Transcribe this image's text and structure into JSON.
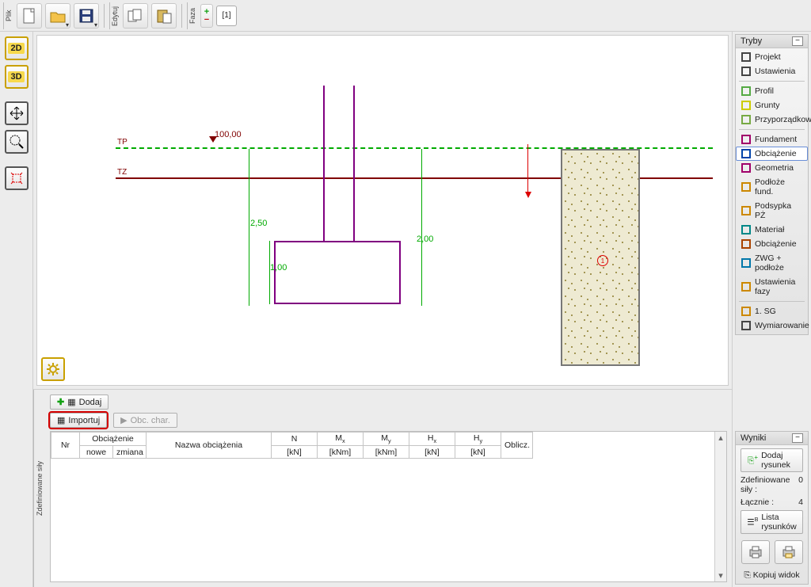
{
  "top": {
    "vert_labels": {
      "plik": "Plik",
      "edytuj": "Edytuj",
      "faza": "Faza"
    },
    "tab_label": "[1]"
  },
  "left": {
    "labels": {
      "btn2d": "2D",
      "btn3d": "3D"
    }
  },
  "canvas": {
    "tp": "TP",
    "tz": "TZ",
    "dim_100": "100,00",
    "dim_250": "2,50",
    "dim_100b": "1,00",
    "dim_200": "2,00",
    "soil_ring": "1"
  },
  "bottom": {
    "vert_label": "Zdefiniowane siły",
    "btn_dodaj": "Dodaj",
    "btn_importuj": "Importuj",
    "btn_obc_char": "Obc. char.",
    "headers": {
      "nr": "Nr",
      "obc": "Obciążenie",
      "obc_sub1": "nowe",
      "obc_sub2": "zmiana",
      "nazwa": "Nazwa obciążenia",
      "n": "N",
      "n_u": "[kN]",
      "mx": "M",
      "mx_u": "[kNm]",
      "my": "M",
      "my_u": "[kNm]",
      "hx": "H",
      "hx_u": "[kN]",
      "hy": "H",
      "hy_u": "[kN]",
      "oblicz": "Oblicz."
    }
  },
  "right": {
    "tryby_title": "Tryby",
    "items": [
      {
        "label": "Projekt",
        "icon": "list"
      },
      {
        "label": "Ustawienia",
        "icon": "gear"
      },
      {
        "label": "Profil",
        "icon": "profile"
      },
      {
        "label": "Grunty",
        "icon": "soil"
      },
      {
        "label": "Przyporządkow.",
        "icon": "assign"
      },
      {
        "label": "Fundament",
        "icon": "found"
      },
      {
        "label": "Obciążenie",
        "icon": "load",
        "selected": true
      },
      {
        "label": "Geometria",
        "icon": "geom"
      },
      {
        "label": "Podłoże fund.",
        "icon": "podloze"
      },
      {
        "label": "Podsypka PŻ",
        "icon": "podsypka"
      },
      {
        "label": "Materiał",
        "icon": "material"
      },
      {
        "label": "Obciążenie",
        "icon": "load2"
      },
      {
        "label": "ZWG + podłoże",
        "icon": "zwg"
      },
      {
        "label": "Ustawienia fazy",
        "icon": "ufazy"
      },
      {
        "label": "1. SG",
        "icon": "sg"
      },
      {
        "label": "Wymiarowanie",
        "icon": "wymiar"
      }
    ],
    "wyniki_title": "Wyniki",
    "btn_dodaj_rys": "Dodaj rysunek",
    "stat1_label": "Zdefiniowane siły :",
    "stat1_val": "0",
    "stat2_label": "Łącznie :",
    "stat2_val": "4",
    "btn_lista_rys": "Lista rysunków",
    "kopiuj": "Kopiuj widok"
  }
}
